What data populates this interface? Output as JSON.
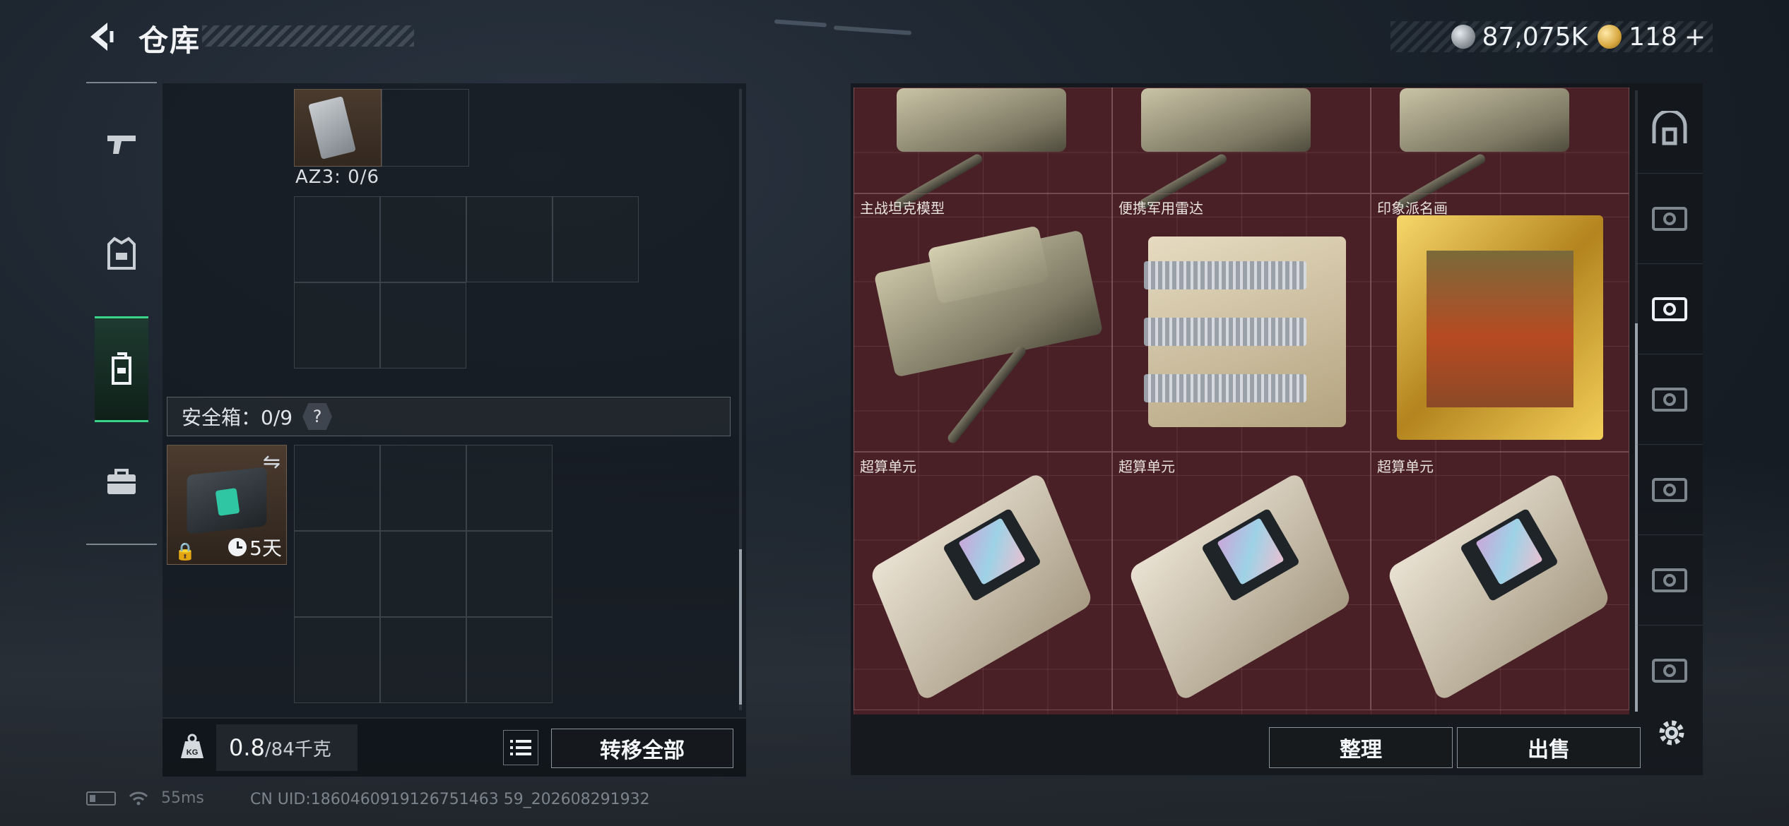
{
  "header": {
    "title": "仓库",
    "currency_silver": "87,075K",
    "currency_gold": "118",
    "currency_plus": "+"
  },
  "left_nav": {
    "items": [
      {
        "name": "weapon",
        "icon": "pistol-icon"
      },
      {
        "name": "equipment",
        "icon": "vest-icon"
      },
      {
        "name": "backpack",
        "icon": "backpack-icon",
        "active": true
      },
      {
        "name": "toolbox",
        "icon": "briefcase-icon"
      }
    ]
  },
  "backpack": {
    "az_label": "AZ3: 0/6",
    "safe_label": "安全箱：0/9",
    "help": "?",
    "safe_timer": "5天"
  },
  "weight": {
    "current": "0.8",
    "max": "/84千克",
    "transfer_label": "转移全部"
  },
  "stash": {
    "items": [
      {
        "name": "主战坦克模型",
        "type": "tank"
      },
      {
        "name": "便携军用雷达",
        "type": "radar"
      },
      {
        "name": "印象派名画",
        "type": "painting"
      },
      {
        "name": "超算单元",
        "type": "cpu"
      },
      {
        "name": "超算单元",
        "type": "cpu"
      },
      {
        "name": "超算单元",
        "type": "cpu"
      }
    ],
    "sort_label": "整理",
    "sell_label": "出售"
  },
  "status": {
    "ping": "55ms",
    "uid": "CN UID:1860460919126751463 59_202608291932"
  },
  "colors": {
    "accent_green": "#37d48a",
    "stash_bg": "#4a2027"
  }
}
